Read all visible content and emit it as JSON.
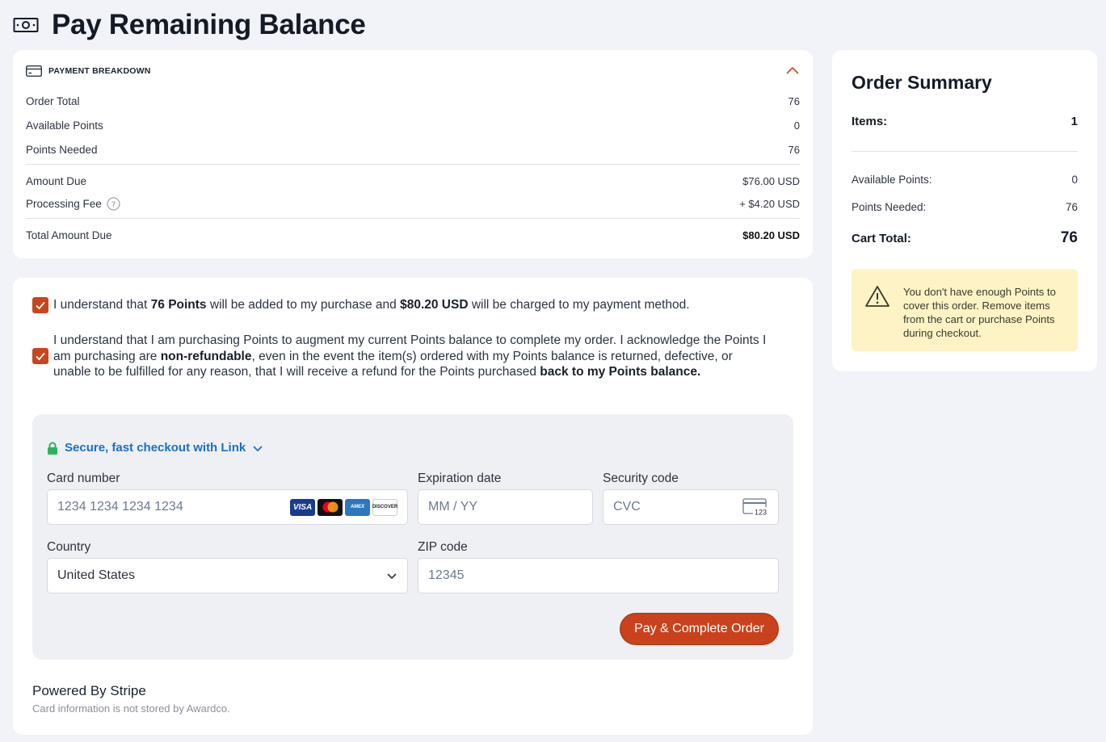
{
  "page": {
    "title": "Pay Remaining Balance"
  },
  "breakdown": {
    "header": "PAYMENT BREAKDOWN",
    "order_total_label": "Order Total",
    "order_total_value": "76",
    "available_points_label": "Available Points",
    "available_points_value": "0",
    "points_needed_label": "Points Needed",
    "points_needed_value": "76",
    "amount_due_label": "Amount Due",
    "amount_due_value": "$76.00 USD",
    "processing_fee_label": "Processing Fee",
    "processing_fee_value": "+ $4.20 USD",
    "total_due_label": "Total Amount Due",
    "total_due_value": "$80.20 USD"
  },
  "consent": {
    "first_pre": "I understand that ",
    "first_points": "76 Points",
    "first_mid": " will be added to my purchase and ",
    "first_amount": "$80.20 USD",
    "first_post": " will be charged to my payment method.",
    "second_pre": "I understand that I am purchasing Points to augment my current Points balance to complete my order. I acknowledge the Points I am purchasing are ",
    "second_bold1": "non-refundable",
    "second_mid": ", even in the event the item(s) ordered with my Points balance is returned, defective, or unable to be fulfilled for any reason, that I will receive a refund for the Points purchased ",
    "second_bold2": "back to my Points balance."
  },
  "stripe": {
    "link_label": "Secure, fast checkout with Link",
    "card_number_label": "Card number",
    "card_number_placeholder": "1234 1234 1234 1234",
    "card_brands": [
      "VISA",
      "MC",
      "AMEX",
      "DISCOVER"
    ],
    "expiration_label": "Expiration date",
    "expiration_placeholder": "MM / YY",
    "security_label": "Security code",
    "security_placeholder": "CVC",
    "cvc_icon_text": "123",
    "country_label": "Country",
    "country_value": "United States",
    "zip_label": "ZIP code",
    "zip_placeholder": "12345",
    "pay_button": "Pay & Complete Order"
  },
  "footer": {
    "powered_by": "Powered By Stripe",
    "not_stored": "Card information is not stored by Awardco."
  },
  "summary": {
    "title": "Order Summary",
    "items_label": "Items:",
    "items_value": "1",
    "available_points_label": "Available Points:",
    "available_points_value": "0",
    "points_needed_label": "Points Needed:",
    "points_needed_value": "76",
    "cart_total_label": "Cart Total:",
    "cart_total_value": "76",
    "warning": "You don't have enough Points to cover this order. Remove items from the cart or purchase Points during checkout."
  },
  "colors": {
    "accent": "#c9461c",
    "link": "#1b6fc4",
    "warning_bg": "#fdf3c4",
    "lock_green": "#2db35d"
  }
}
